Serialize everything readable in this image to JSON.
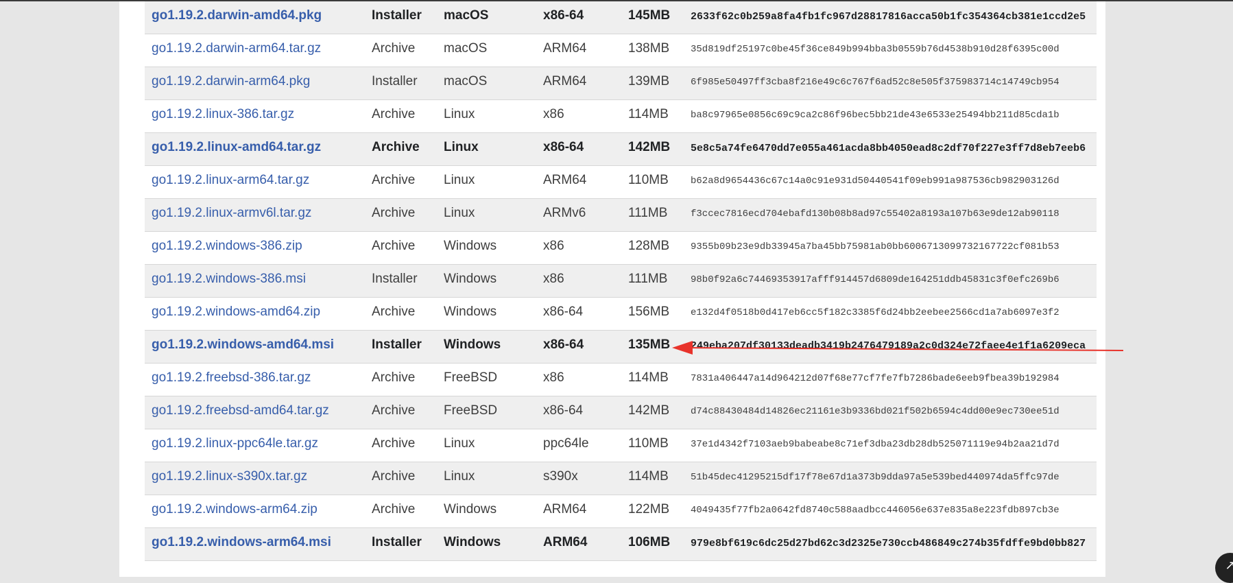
{
  "rows": [
    {
      "file": "go1.19.2.darwin-amd64.pkg",
      "kind": "Installer",
      "os": "macOS",
      "arch": "x86-64",
      "size": "145MB",
      "checksum": "2633f62c0b259a8fa4fb1fc967d28817816acca50b1fc354364cb381e1ccd2e5",
      "featured": true
    },
    {
      "file": "go1.19.2.darwin-arm64.tar.gz",
      "kind": "Archive",
      "os": "macOS",
      "arch": "ARM64",
      "size": "138MB",
      "checksum": "35d819df25197c0be45f36ce849b994bba3b0559b76d4538b910d28f6395c00d",
      "featured": false
    },
    {
      "file": "go1.19.2.darwin-arm64.pkg",
      "kind": "Installer",
      "os": "macOS",
      "arch": "ARM64",
      "size": "139MB",
      "checksum": "6f985e50497ff3cba8f216e49c6c767f6ad52c8e505f375983714c14749cb954",
      "featured": false
    },
    {
      "file": "go1.19.2.linux-386.tar.gz",
      "kind": "Archive",
      "os": "Linux",
      "arch": "x86",
      "size": "114MB",
      "checksum": "ba8c97965e0856c69c9ca2c86f96bec5bb21de43e6533e25494bb211d85cda1b",
      "featured": false
    },
    {
      "file": "go1.19.2.linux-amd64.tar.gz",
      "kind": "Archive",
      "os": "Linux",
      "arch": "x86-64",
      "size": "142MB",
      "checksum": "5e8c5a74fe6470dd7e055a461acda8bb4050ead8c2df70f227e3ff7d8eb7eeb6",
      "featured": true
    },
    {
      "file": "go1.19.2.linux-arm64.tar.gz",
      "kind": "Archive",
      "os": "Linux",
      "arch": "ARM64",
      "size": "110MB",
      "checksum": "b62a8d9654436c67c14a0c91e931d50440541f09eb991a987536cb982903126d",
      "featured": false
    },
    {
      "file": "go1.19.2.linux-armv6l.tar.gz",
      "kind": "Archive",
      "os": "Linux",
      "arch": "ARMv6",
      "size": "111MB",
      "checksum": "f3ccec7816ecd704ebafd130b08b8ad97c55402a8193a107b63e9de12ab90118",
      "featured": false
    },
    {
      "file": "go1.19.2.windows-386.zip",
      "kind": "Archive",
      "os": "Windows",
      "arch": "x86",
      "size": "128MB",
      "checksum": "9355b09b23e9db33945a7ba45bb75981ab0bb6006713099732167722cf081b53",
      "featured": false
    },
    {
      "file": "go1.19.2.windows-386.msi",
      "kind": "Installer",
      "os": "Windows",
      "arch": "x86",
      "size": "111MB",
      "checksum": "98b0f92a6c74469353917afff914457d6809de164251ddb45831c3f0efc269b6",
      "featured": false
    },
    {
      "file": "go1.19.2.windows-amd64.zip",
      "kind": "Archive",
      "os": "Windows",
      "arch": "x86-64",
      "size": "156MB",
      "checksum": "e132d4f0518b0d417eb6cc5f182c3385f6d24bb2eebee2566cd1a7ab6097e3f2",
      "featured": false
    },
    {
      "file": "go1.19.2.windows-amd64.msi",
      "kind": "Installer",
      "os": "Windows",
      "arch": "x86-64",
      "size": "135MB",
      "checksum": "249eba207df30133deadb3419b2476479189a2c0d324e72faee4e1f1a6209eca",
      "featured": true
    },
    {
      "file": "go1.19.2.freebsd-386.tar.gz",
      "kind": "Archive",
      "os": "FreeBSD",
      "arch": "x86",
      "size": "114MB",
      "checksum": "7831a406447a14d964212d07f68e77cf7fe7fb7286bade6eeb9fbea39b192984",
      "featured": false
    },
    {
      "file": "go1.19.2.freebsd-amd64.tar.gz",
      "kind": "Archive",
      "os": "FreeBSD",
      "arch": "x86-64",
      "size": "142MB",
      "checksum": "d74c88430484d14826ec21161e3b9336bd021f502b6594c4dd00e9ec730ee51d",
      "featured": false
    },
    {
      "file": "go1.19.2.linux-ppc64le.tar.gz",
      "kind": "Archive",
      "os": "Linux",
      "arch": "ppc64le",
      "size": "110MB",
      "checksum": "37e1d4342f7103aeb9babeabe8c71ef3dba23db28db525071119e94b2aa21d7d",
      "featured": false
    },
    {
      "file": "go1.19.2.linux-s390x.tar.gz",
      "kind": "Archive",
      "os": "Linux",
      "arch": "s390x",
      "size": "114MB",
      "checksum": "51b45dec41295215df17f78e67d1a373b9dda97a5e539bed440974da5ffc97de",
      "featured": false
    },
    {
      "file": "go1.19.2.windows-arm64.zip",
      "kind": "Archive",
      "os": "Windows",
      "arch": "ARM64",
      "size": "122MB",
      "checksum": "4049435f77fb2a0642fd8740c588aadbcc446056e637e835a8e223fdb897cb3e",
      "featured": false
    },
    {
      "file": "go1.19.2.windows-arm64.msi",
      "kind": "Installer",
      "os": "Windows",
      "arch": "ARM64",
      "size": "106MB",
      "checksum": "979e8bf619c6dc25d27bd62c3d2325e730ccb486849c274b35fdffe9bd0bb827",
      "featured": true
    }
  ],
  "annotation": {
    "arrow_color": "#e8332b",
    "points_to": "go1.19.2.windows-amd64.msi"
  },
  "colors": {
    "link": "#375eab",
    "shade": "#efefef",
    "text": "#3e3e3e"
  },
  "corner_icon": "arrow-up-icon"
}
